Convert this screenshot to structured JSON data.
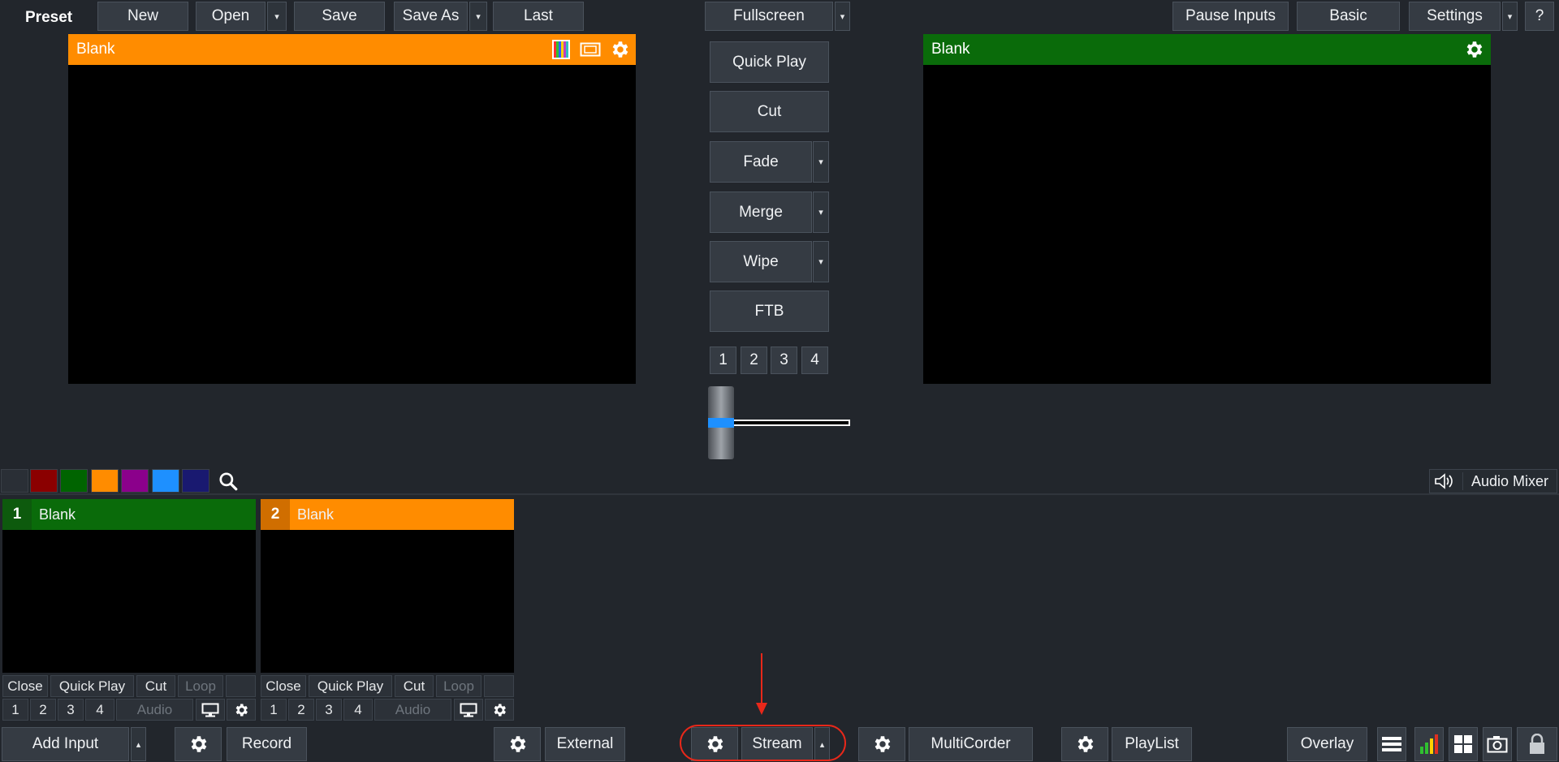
{
  "topbar": {
    "preset_label": "Preset",
    "new_label": "New",
    "open_label": "Open",
    "save_label": "Save",
    "save_as_label": "Save As",
    "last_label": "Last",
    "fullscreen_label": "Fullscreen",
    "pause_inputs_label": "Pause Inputs",
    "basic_label": "Basic",
    "settings_label": "Settings",
    "help_label": "?"
  },
  "preview": {
    "title": "Blank",
    "header_color": "#ff8c00"
  },
  "output": {
    "title": "Blank",
    "header_color": "#0a6b0a"
  },
  "transitions": {
    "quick_play_label": "Quick Play",
    "cut_label": "Cut",
    "fade_label": "Fade",
    "merge_label": "Merge",
    "wipe_label": "Wipe",
    "ftb_label": "FTB",
    "numbers": [
      "1",
      "2",
      "3",
      "4"
    ],
    "tbar_level": 0
  },
  "color_filter": {
    "swatches": [
      "#2a2f36",
      "#8b0000",
      "#006400",
      "#ff8c00",
      "#8b008b",
      "#1e90ff",
      "#191970"
    ],
    "search_icon": "search-icon"
  },
  "audio_mixer": {
    "label": "Audio Mixer",
    "icon": "speaker-icon"
  },
  "inputs": [
    {
      "number": "1",
      "title": "Blank",
      "header_color": "#0a6b0a",
      "number_bg": "#0d5a0d",
      "close_label": "Close",
      "quick_play_label": "Quick Play",
      "cut_label": "Cut",
      "loop_label": "Loop",
      "audio_label": "Audio",
      "numbers": [
        "1",
        "2",
        "3",
        "4"
      ]
    },
    {
      "number": "2",
      "title": "Blank",
      "header_color": "#ff8c00",
      "number_bg": "#d06e00",
      "close_label": "Close",
      "quick_play_label": "Quick Play",
      "cut_label": "Cut",
      "loop_label": "Loop",
      "audio_label": "Audio",
      "numbers": [
        "1",
        "2",
        "3",
        "4"
      ]
    }
  ],
  "bottombar": {
    "add_input_label": "Add Input",
    "record_label": "Record",
    "external_label": "External",
    "stream_label": "Stream",
    "multicorder_label": "MultiCorder",
    "playlist_label": "PlayList",
    "overlay_label": "Overlay"
  },
  "annotation": {
    "highlight_color": "#e8281a"
  },
  "colors": {
    "background": "#22262c",
    "button": "#353b43",
    "accent_blue": "#1e90ff"
  }
}
